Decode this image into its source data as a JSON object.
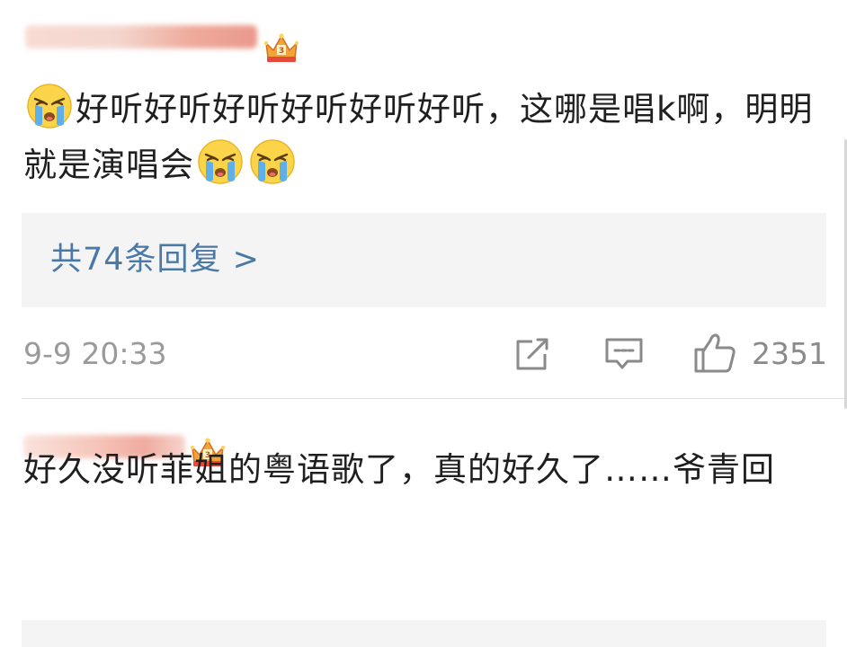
{
  "comments": [
    {
      "username": "",
      "text_part1": "好听好听好听好听好听好听，这哪是唱k啊，明明就是演唱会",
      "emojis": [
        "crying-face",
        "crying-face",
        "crying-face"
      ],
      "replies_label": "共74条回复 >",
      "timestamp": "9-9 20:33",
      "likes": "2351"
    },
    {
      "username": "",
      "text": "好久没听菲姐的粤语歌了，真的好久了……爷青回"
    }
  ],
  "icons": {
    "badge": "crown-icon",
    "share": "share-icon",
    "comment": "comment-icon",
    "like": "thumbs-up-icon"
  },
  "colors": {
    "link": "#4a78a7",
    "meta": "#9a9a9a",
    "box": "#f4f4f4"
  }
}
